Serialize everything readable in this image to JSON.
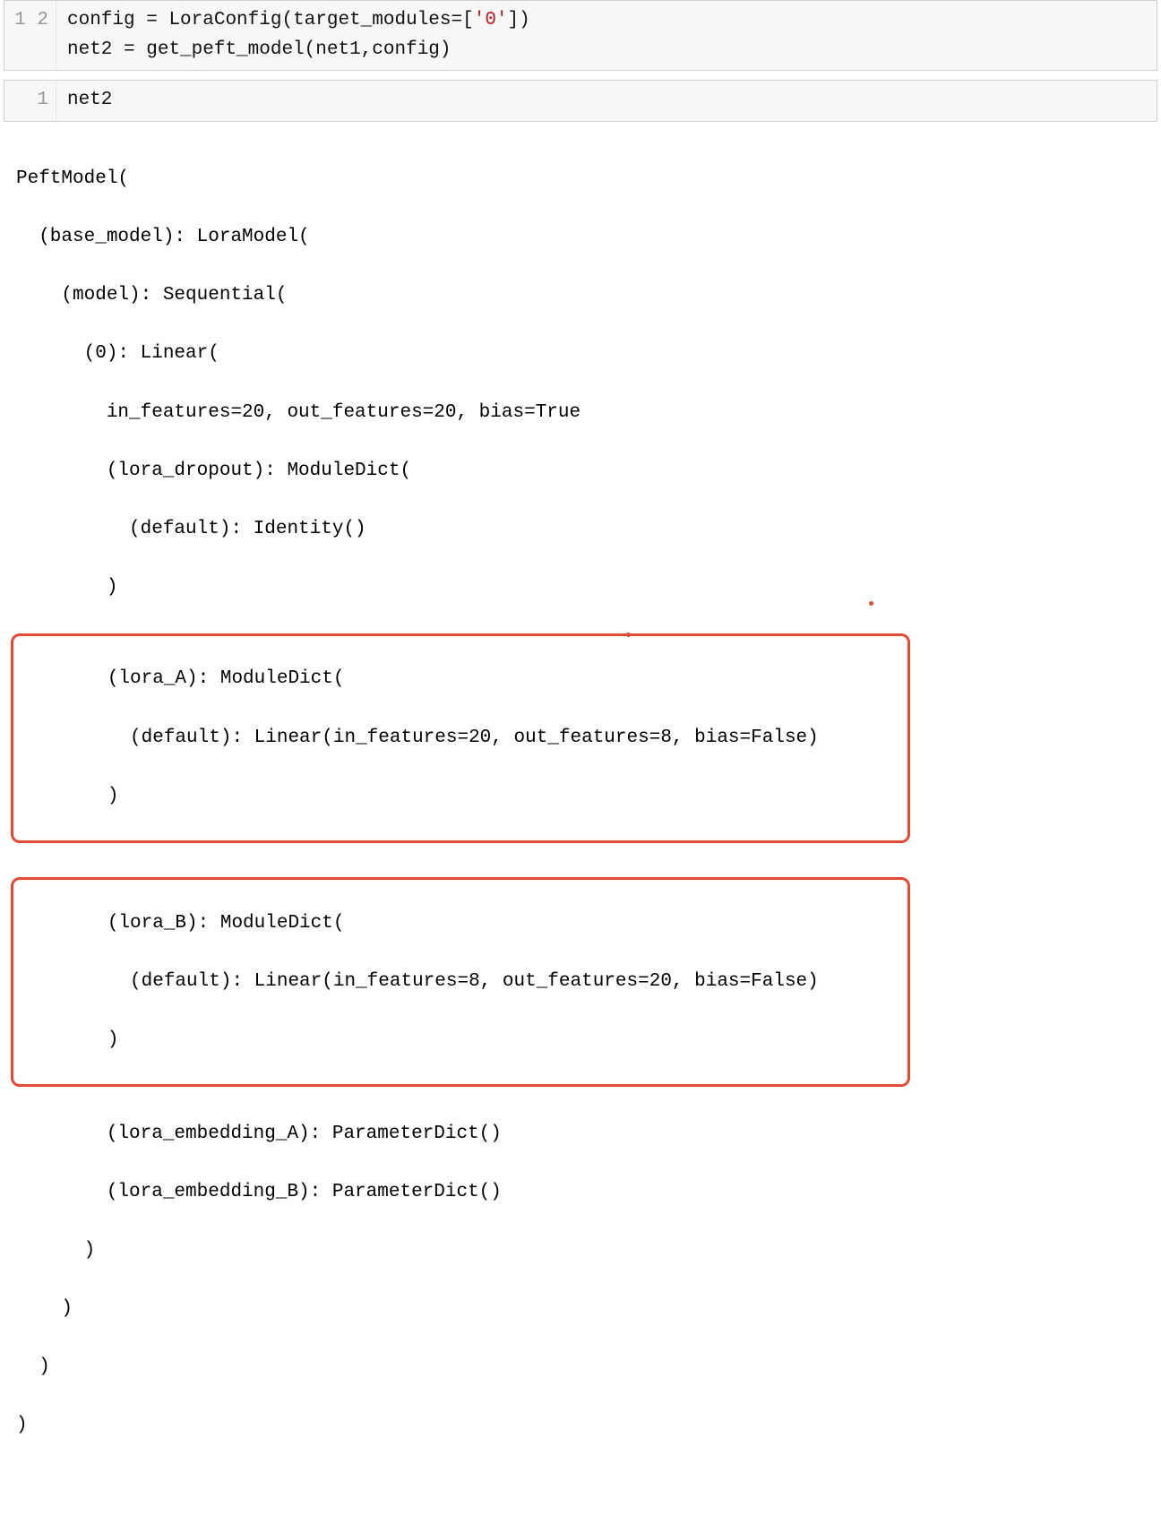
{
  "cell1": {
    "lineNumbers": [
      "1",
      "2"
    ],
    "line1": {
      "a": "config ",
      "eq": "=",
      "sp": " ",
      "fn": "LoraConfig",
      "open": "(target_modules",
      "eq2": "=",
      "br": "[",
      "str": "'0'",
      "close": "])"
    },
    "line2": {
      "a": "net2 ",
      "eq": "=",
      "sp": " ",
      "fn": "get_peft_model",
      "args": "(net1,config)"
    }
  },
  "cell2": {
    "lineNumbers": [
      "1"
    ],
    "code": "net2"
  },
  "output": {
    "l0": "PeftModel(",
    "l1": "  (base_model): LoraModel(",
    "l2": "    (model): Sequential(",
    "l3": "      (0): Linear(",
    "l4": "        in_features=20, out_features=20, bias=True",
    "l5": "        (lora_dropout): ModuleDict(",
    "l6": "          (default): Identity()",
    "l7": "        )",
    "hA1": "        (lora_A): ModuleDict(",
    "hA2": "          (default): Linear(in_features=20, out_features=8, bias=False)",
    "hA3": "        )",
    "hB1": "        (lora_B): ModuleDict(",
    "hB2": "          (default): Linear(in_features=8, out_features=20, bias=False)",
    "hB3": "        )",
    "l8": "        (lora_embedding_A): ParameterDict()",
    "l9": "        (lora_embedding_B): ParameterDict()",
    "l10": "      )",
    "l11": "    )",
    "l12": "  )",
    "l13": ")"
  }
}
